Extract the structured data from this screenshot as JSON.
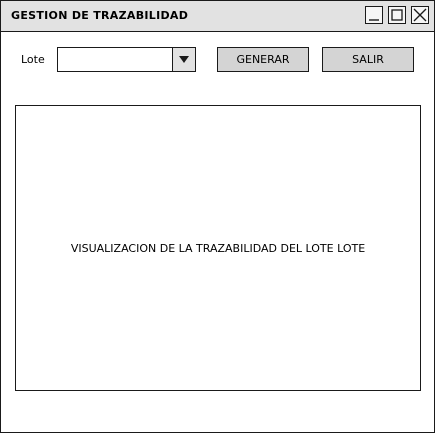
{
  "window": {
    "title": "GESTION DE TRAZABILIDAD"
  },
  "form": {
    "lote_label": "Lote",
    "lote_value": "",
    "generar_label": "GENERAR",
    "salir_label": "SALIR"
  },
  "visualization": {
    "text": "VISUALIZACION DE LA TRAZABILIDAD DEL LOTE LOTE"
  },
  "icons": {
    "minimize": "minimize-icon",
    "maximize": "maximize-icon",
    "close": "close-icon",
    "dropdown": "triangle-down-icon"
  },
  "colors": {
    "titlebar": "#e2e2e2",
    "button": "#d4d4d4",
    "border": "#1a1a1a"
  }
}
